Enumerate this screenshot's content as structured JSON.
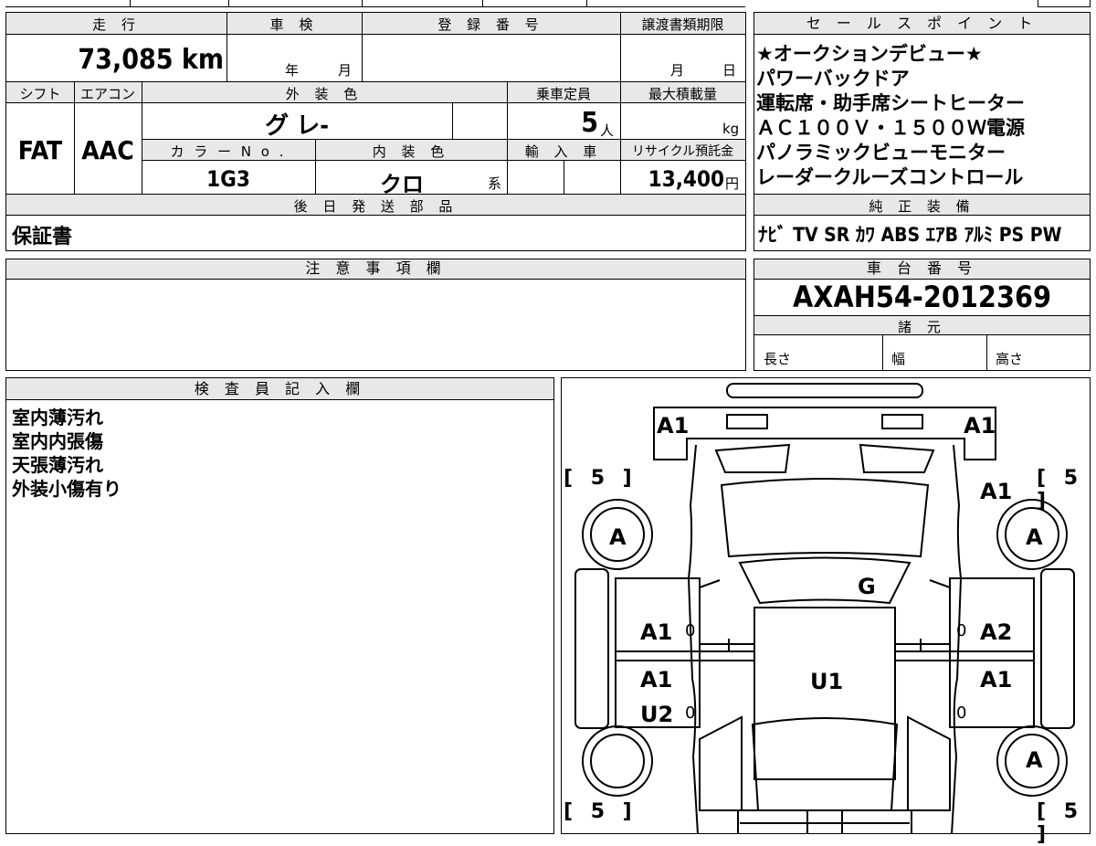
{
  "left": {
    "mileage_header": "走 行",
    "mileage_value": "73,085 km",
    "shaken_header": "車 検",
    "shaken_year": "年",
    "shaken_month": "月",
    "reg_header": "登 録 番 号",
    "transfer_header": "譲渡書類期限",
    "transfer_month": "月",
    "transfer_day": "日",
    "shift_header": "シフト",
    "shift_value": "FAT",
    "aircon_header": "エアコン",
    "aircon_value": "AAC",
    "exterior_header": "外 装 色",
    "exterior_value": "グ レ-",
    "capacity_header": "乗車定員",
    "capacity_value": "5",
    "capacity_unit": "人",
    "maxload_header": "最大積載量",
    "maxload_unit": "kg",
    "colorno_header": "カ ラ ー N o .",
    "colorno_value": "1G3",
    "interior_header": "内 装 色",
    "interior_value": "クロ",
    "interior_suffix": "系",
    "import_header": "輸 入 車",
    "recycle_header": "リサイクル預託金",
    "recycle_value": "13,400",
    "recycle_unit": "円",
    "later_header": "後 日 発 送 部 品",
    "later_value": "保証書",
    "notes_header": "注 意 事 項 欄",
    "inspector_header": "検 査 員 記 入 欄",
    "inspector_lines": [
      "室内薄汚れ",
      "室内内張傷",
      "天張薄汚れ",
      "外装小傷有り"
    ]
  },
  "right": {
    "sales_header": "セ ー ル ス ポ イ ン ト",
    "sales_lines": [
      "★オークションデビュー★",
      "パワーバックドア",
      "運転席・助手席シートヒーター",
      "ＡＣ１００Ｖ・１５００Ｗ電源",
      "パノラミックビューモニター",
      "レーダークルーズコントロール"
    ],
    "equipment_header": "純 正 装 備",
    "equipment_value": "ﾅﾋﾞ TV SR ｶﾜ ABS ｴｱB ｱﾙﾐ PS PW",
    "chassis_header": "車 台 番 号",
    "chassis_value": "AXAH54-2012369",
    "specs_header": "諸 元",
    "spec_length": "長さ",
    "spec_width": "幅",
    "spec_height": "高さ"
  },
  "diagram": {
    "codes": [
      "A1",
      "A1",
      "A1",
      "A",
      "A",
      "G",
      "A1",
      "A2",
      "A1",
      "U1",
      "A1",
      "A1",
      "U2",
      "A"
    ],
    "tire_marks": [
      "[ 5 ]",
      "[ 5 ]",
      "[ 5 ]",
      "[ 5 ]"
    ],
    "zeros": [
      "0",
      "0",
      "0",
      "0"
    ]
  }
}
